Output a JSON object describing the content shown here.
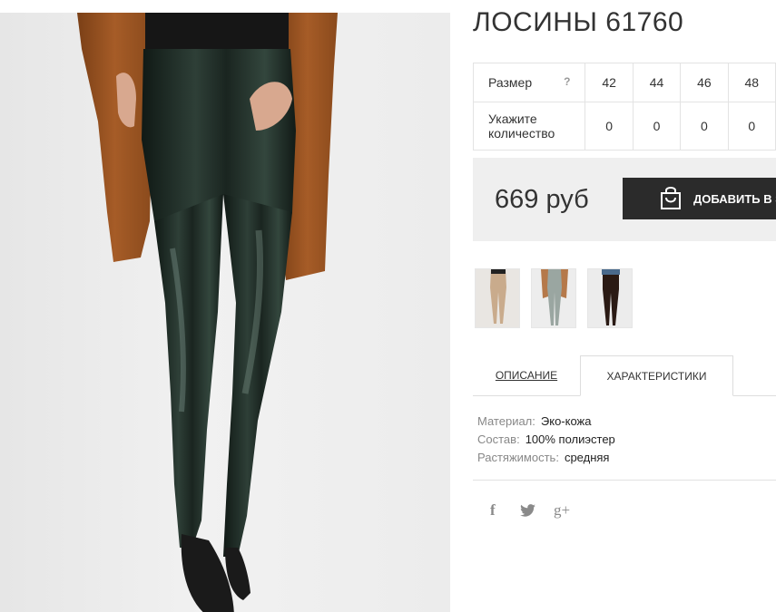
{
  "product": {
    "title": "ЛОСИНЫ 61760",
    "price": "669 руб",
    "add_to_cart_label": "ДОБАВИТЬ В З"
  },
  "sizes": {
    "size_label": "Размер",
    "help": "?",
    "qty_label_line1": "Укажите",
    "qty_label_line2": "количество",
    "columns": [
      {
        "size": "42",
        "qty": "0"
      },
      {
        "size": "44",
        "qty": "0"
      },
      {
        "size": "46",
        "qty": "0"
      },
      {
        "size": "48",
        "qty": "0"
      }
    ]
  },
  "tabs": {
    "description": "ОПИСАНИЕ",
    "characteristics": "ХАРАКТЕРИСТИКИ",
    "active": "characteristics"
  },
  "specs": [
    {
      "key": "Материал:",
      "value": "Эко-кожа"
    },
    {
      "key": "Состав:",
      "value": "100% полиэстер"
    },
    {
      "key": "Растяжимость:",
      "value": "средняя"
    }
  ],
  "social": {
    "facebook": "f",
    "twitter": "twitter-icon",
    "google": "g+"
  },
  "thumbnails": [
    {
      "icon": "beige-leggings-thumbnail"
    },
    {
      "icon": "grey-leggings-thumbnail"
    },
    {
      "icon": "black-leggings-thumbnail"
    }
  ],
  "colors": {
    "dark_button": "#2b2b2b",
    "price_bg": "#efefef",
    "legging_green": "#1f2c27",
    "coat_brown": "#a35a24"
  }
}
